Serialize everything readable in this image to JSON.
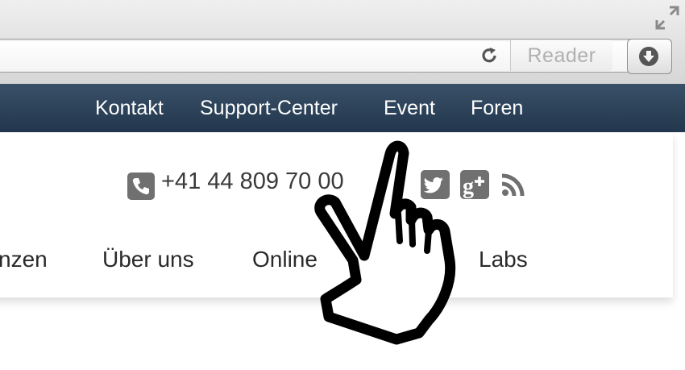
{
  "browser": {
    "reader_label": "Reader",
    "icons": [
      "fullscreen-icon",
      "reload-icon",
      "download-icon"
    ]
  },
  "topnav": {
    "items": [
      {
        "label": "Kontakt"
      },
      {
        "label": "Support-Center"
      },
      {
        "label": "Event"
      },
      {
        "label": "Foren"
      }
    ],
    "background": "#2a3f55"
  },
  "header": {
    "phone": "+41 44 809 70 00",
    "social_icons": [
      "twitter-icon",
      "google-plus-icon",
      "rss-icon"
    ],
    "icon_color": "#707070"
  },
  "mainnav": {
    "items": [
      {
        "label": "nzen"
      },
      {
        "label": "Über uns"
      },
      {
        "label": "Online"
      },
      {
        "label": "Labs"
      }
    ]
  },
  "cursor": {
    "icon": "hand-pointer-icon"
  }
}
